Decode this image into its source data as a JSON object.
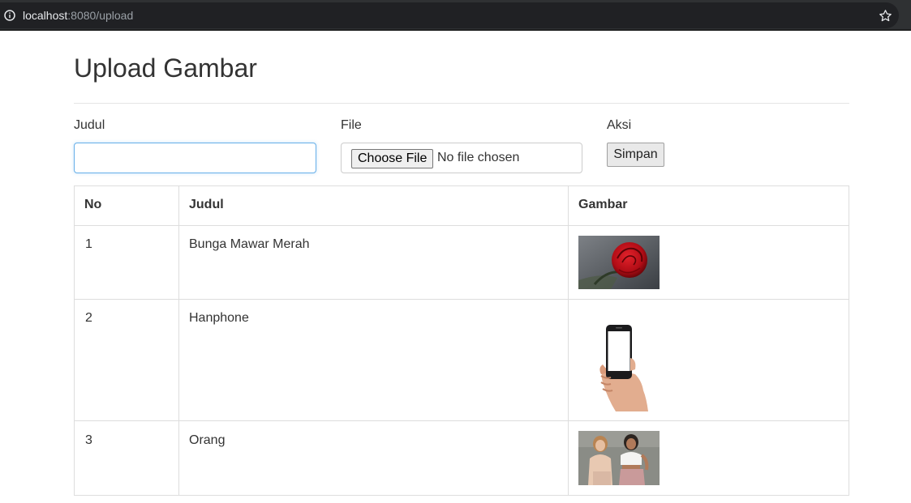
{
  "browser": {
    "url_host": "localhost",
    "url_rest": ":8080/upload"
  },
  "page": {
    "title": "Upload Gambar"
  },
  "form": {
    "judul_label": "Judul",
    "judul_value": "",
    "file_label": "File",
    "choose_file_label": "Choose File",
    "no_file_text": "No file chosen",
    "aksi_label": "Aksi",
    "simpan_label": "Simpan"
  },
  "table": {
    "headers": [
      "No",
      "Judul",
      "Gambar"
    ],
    "rows": [
      {
        "no": "1",
        "judul": "Bunga Mawar Merah",
        "image": "red-rose-image"
      },
      {
        "no": "2",
        "judul": "Hanphone",
        "image": "hand-holding-phone-image"
      },
      {
        "no": "3",
        "judul": "Orang",
        "image": "two-women-image"
      }
    ]
  },
  "colors": {
    "accent_focus": "#66afe9",
    "border": "#dddddd",
    "rose_red": "#c0111a"
  }
}
